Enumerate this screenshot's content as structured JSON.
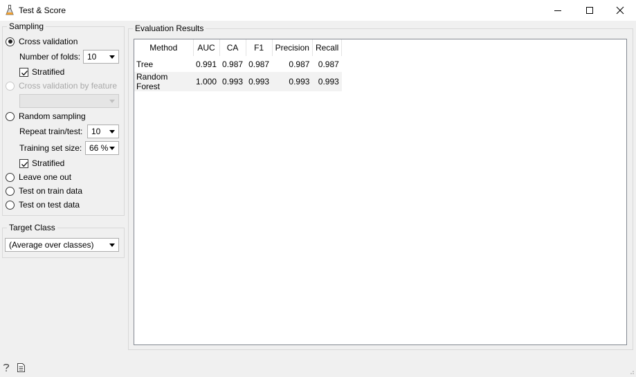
{
  "window": {
    "title": "Test & Score",
    "icons": {
      "app": "flask-icon",
      "minimize": "minimize-icon",
      "maximize": "maximize-icon",
      "close": "close-icon"
    }
  },
  "sampling": {
    "legend": "Sampling",
    "cross_validation": {
      "label": "Cross validation",
      "selected": true,
      "folds_label": "Number of folds:",
      "folds_value": "10",
      "stratified_label": "Stratified",
      "stratified_checked": true
    },
    "cv_by_feature": {
      "label": "Cross validation by feature",
      "enabled": false,
      "value": ""
    },
    "random_sampling": {
      "label": "Random sampling",
      "repeat_label": "Repeat train/test:",
      "repeat_value": "10",
      "train_size_label": "Training set size:",
      "train_size_value": "66 %",
      "stratified_label": "Stratified",
      "stratified_checked": true
    },
    "leave_one_out": {
      "label": "Leave one out"
    },
    "test_on_train": {
      "label": "Test on train data"
    },
    "test_on_test": {
      "label": "Test on test data"
    }
  },
  "target_class": {
    "legend": "Target Class",
    "value": "(Average over classes)"
  },
  "evaluation": {
    "legend": "Evaluation Results",
    "columns": [
      "Method",
      "AUC",
      "CA",
      "F1",
      "Precision",
      "Recall"
    ],
    "rows": [
      [
        "Tree",
        "0.991",
        "0.987",
        "0.987",
        "0.987",
        "0.987"
      ],
      [
        "Random Forest",
        "1.000",
        "0.993",
        "0.993",
        "0.993",
        "0.993"
      ]
    ]
  },
  "statusbar": {
    "help_icon": "help-icon",
    "report_icon": "report-icon"
  }
}
